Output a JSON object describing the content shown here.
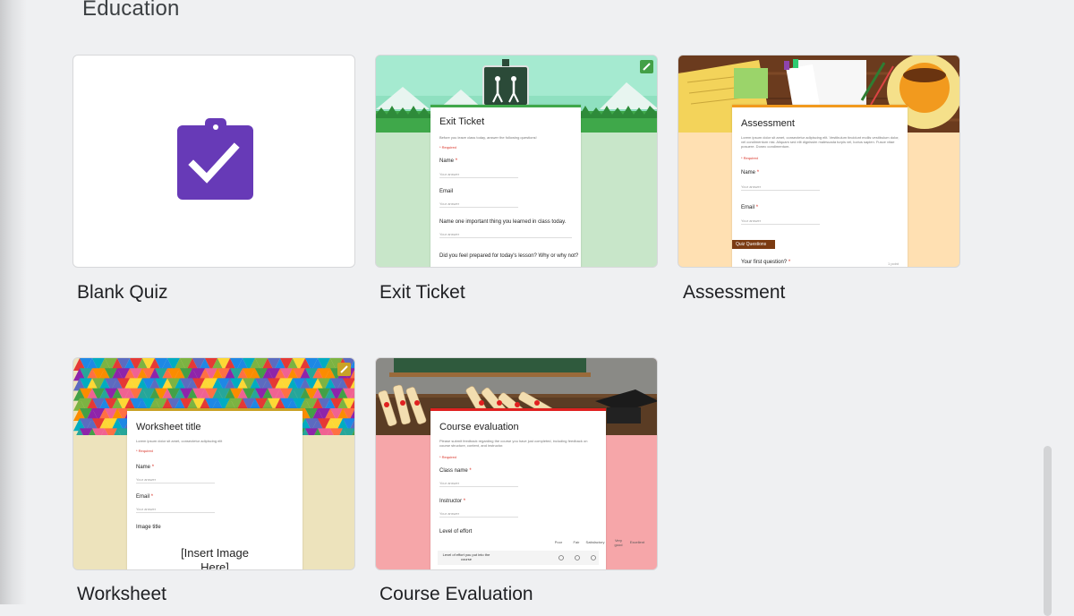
{
  "section": {
    "title": "Education"
  },
  "templates": [
    {
      "label": "Blank Quiz"
    },
    {
      "label": "Exit Ticket",
      "form": {
        "title": "Exit Ticket",
        "description": "Before you leave class today, answer the following questions!",
        "required": "* Required",
        "questions": [
          {
            "text": "Name",
            "required": true,
            "answer": "Your answer"
          },
          {
            "text": "Email",
            "required": false,
            "answer": "Your answer"
          },
          {
            "text": "Name one important thing you learned in class today.",
            "required": false,
            "answer": "Your answer"
          },
          {
            "text": "Did you feel prepared for today's lesson? Why or why not?",
            "required": false,
            "answer": ""
          }
        ]
      }
    },
    {
      "label": "Assessment",
      "form": {
        "title": "Assessment",
        "description": "Lorem ipsum dolor sit amet, consectetur adipiscing elit. Vestibulum tincidunt mollis vestibulum dolor, vel condimentum nisi. Aliquam sed elit dignissim malesuada turpis vel, luctus sapien. Fusce vitae posuere. Donec condimentum.",
        "required": "* Required",
        "questions": [
          {
            "text": "Name",
            "required": true,
            "answer": "Your answer"
          },
          {
            "text": "Email",
            "required": true,
            "answer": "Your answer"
          }
        ],
        "section_badge": "Quiz Questions",
        "first_question": "Your first question?",
        "points": "1 point"
      }
    },
    {
      "label": "Worksheet",
      "form": {
        "title": "Worksheet title",
        "description": "Lorem ipsum dolor sit amet, consectetur adipiscing elit",
        "required": "* Required",
        "questions": [
          {
            "text": "Name",
            "required": true,
            "answer": "Your answer"
          },
          {
            "text": "Email",
            "required": true,
            "answer": "Your answer"
          }
        ],
        "image_title": "Image title",
        "image_placeholder": "[Insert Image Here]"
      }
    },
    {
      "label": "Course Evaluation",
      "form": {
        "title": "Course evaluation",
        "description": "Please submit feedback regarding the course you have just completed, including feedback on course structure, content, and instructor.",
        "required": "* Required",
        "questions": [
          {
            "text": "Class name",
            "required": true,
            "answer": "Your answer"
          },
          {
            "text": "Instructor",
            "required": true,
            "answer": "Your answer"
          }
        ],
        "grid_question": "Level of effort",
        "grid_columns": [
          "Poor",
          "Fair",
          "Satisfactory",
          "Very good",
          "Excellent"
        ],
        "grid_row": "Level of effort you put into the course"
      }
    }
  ],
  "colors": {
    "quiz_purple": "#673ab7",
    "exit_green": "#c8e6c9",
    "assessment_peach": "#ffe0b2",
    "worksheet_khaki": "#ede3bc",
    "course_pink": "#f6a6a9",
    "required_red": "#d93025"
  },
  "icons": [
    "clipboard-check-icon",
    "pencil-icon"
  ]
}
